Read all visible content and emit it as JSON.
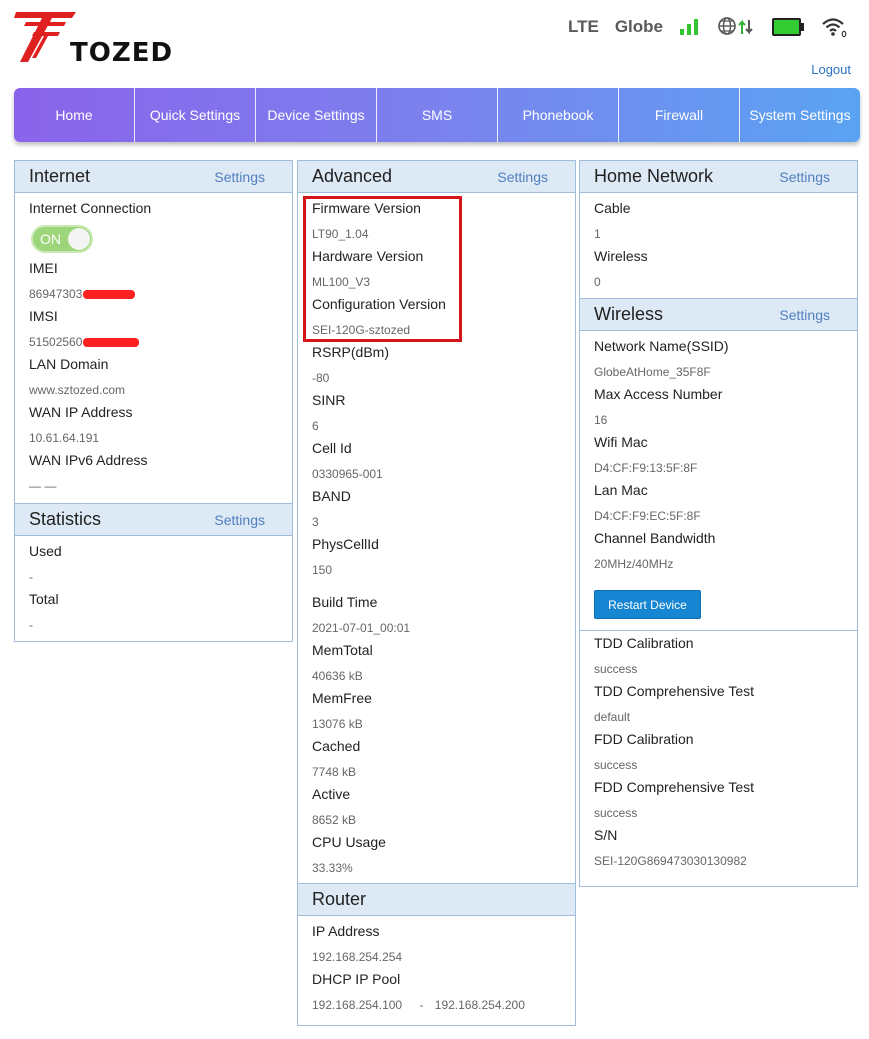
{
  "header": {
    "logo_text": "TOZED",
    "network_type": "LTE",
    "operator": "Globe",
    "logout_label": "Logout"
  },
  "colors": {
    "nav_start": "#8a63ea",
    "nav_end": "#5aa3f2",
    "panel_header": "#dde9f5",
    "link": "#4f7fbf",
    "button": "#1685d2",
    "highlight": "#d6151b"
  },
  "nav": [
    "Home",
    "Quick Settings",
    "Device Settings",
    "SMS",
    "Phonebook",
    "Firewall",
    "System Settings"
  ],
  "internet": {
    "title": "Internet",
    "settings": "Settings",
    "connection_label": "Internet Connection",
    "toggle": "ON",
    "imei_label": "IMEI",
    "imei_value": "86947303",
    "imsi_label": "IMSI",
    "imsi_value": "51502560",
    "lan_domain_label": "LAN Domain",
    "lan_domain_value": "www.sztozed.com",
    "wan_ip_label": "WAN IP Address",
    "wan_ip_value": "10.61.64.191",
    "wan_ipv6_label": "WAN IPv6 Address",
    "wan_ipv6_value": "— —"
  },
  "statistics": {
    "title": "Statistics",
    "settings": "Settings",
    "used_label": "Used",
    "used_value": "-",
    "total_label": "Total",
    "total_value": "-"
  },
  "advanced": {
    "title": "Advanced",
    "settings": "Settings",
    "items": [
      {
        "label": "Firmware Version",
        "value": "LT90_1.04"
      },
      {
        "label": "Hardware Version",
        "value": "ML100_V3"
      },
      {
        "label": "Configuration Version",
        "value": "SEI-120G-sztozed"
      },
      {
        "label": "RSRP(dBm)",
        "value": "-80"
      },
      {
        "label": "SINR",
        "value": "6"
      },
      {
        "label": "Cell Id",
        "value": "0330965-001"
      },
      {
        "label": "BAND",
        "value": "3"
      },
      {
        "label": "PhysCellId",
        "value": "150"
      },
      {
        "label": "Build Time",
        "value": "2021-07-01_00:01"
      },
      {
        "label": "MemTotal",
        "value": "40636 kB"
      },
      {
        "label": "MemFree",
        "value": "13076 kB"
      },
      {
        "label": "Cached",
        "value": "7748 kB"
      },
      {
        "label": "Active",
        "value": "8652 kB"
      },
      {
        "label": "CPU Usage",
        "value": "33.33%"
      }
    ]
  },
  "router": {
    "title": "Router",
    "ip_label": "IP Address",
    "ip_value": "192.168.254.254",
    "dhcp_label": "DHCP IP Pool",
    "dhcp_start": "192.168.254.100",
    "dhcp_sep": "-",
    "dhcp_end": "192.168.254.200"
  },
  "home_network": {
    "title": "Home Network",
    "settings": "Settings",
    "cable_label": "Cable",
    "cable_value": "1",
    "wireless_label": "Wireless",
    "wireless_value": "0"
  },
  "wireless": {
    "title": "Wireless",
    "settings": "Settings",
    "ssid_label": "Network Name(SSID)",
    "ssid_value": "GlobeAtHome_35F8F",
    "max_label": "Max Access Number",
    "max_value": "16",
    "wifi_mac_label": "Wifi Mac",
    "wifi_mac_value": "D4:CF:F9:13:5F:8F",
    "lan_mac_label": "Lan Mac",
    "lan_mac_value": "D4:CF:F9:EC:5F:8F",
    "bw_label": "Channel Bandwidth",
    "bw_value": "20MHz/40MHz",
    "restart_label": "Restart Device",
    "tdd_cal_label": "TDD Calibration",
    "tdd_cal_value": "success",
    "tdd_test_label": "TDD Comprehensive Test",
    "tdd_test_value": "default",
    "fdd_cal_label": "FDD Calibration",
    "fdd_cal_value": "success",
    "fdd_test_label": "FDD Comprehensive Test",
    "fdd_test_value": "success",
    "sn_label": "S/N",
    "sn_value": "SEI-120G869473030130982"
  }
}
